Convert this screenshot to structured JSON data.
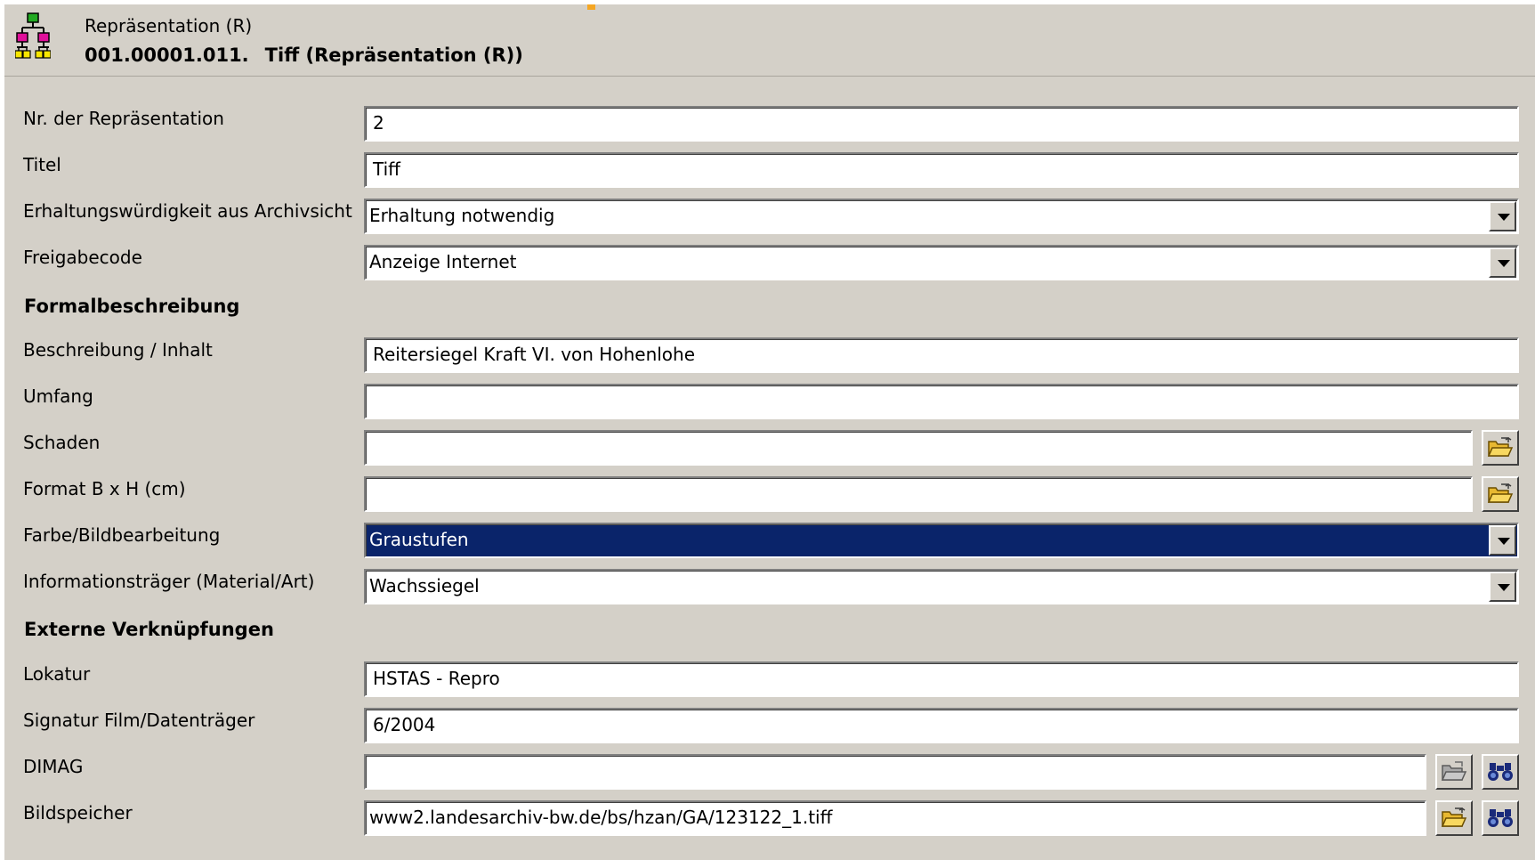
{
  "header": {
    "subtitle": "Repräsentation (R)",
    "title_number": "001.00001.011.",
    "title_text": "Tiff (Repräsentation (R))",
    "icon": "hierarchy-tree-icon"
  },
  "fields": {
    "nr": {
      "label": "Nr. der Repräsentation",
      "value": "2"
    },
    "titel": {
      "label": "Titel",
      "value": "Tiff"
    },
    "erhaltung": {
      "label": "Erhaltungswürdigkeit aus Archivsicht",
      "value": "Erhaltung notwendig"
    },
    "freigabe": {
      "label": "Freigabecode",
      "value": "Anzeige Internet"
    },
    "beschreibung": {
      "label": "Beschreibung / Inhalt",
      "value": "Reitersiegel Kraft VI. von Hohenlohe"
    },
    "umfang": {
      "label": "Umfang",
      "value": ""
    },
    "schaden": {
      "label": "Schaden",
      "value": ""
    },
    "format": {
      "label": "Format B x H (cm)",
      "value": ""
    },
    "farbe": {
      "label": "Farbe/Bildbearbeitung",
      "value": "Graustufen"
    },
    "traeger": {
      "label": "Informationsträger (Material/Art)",
      "value": "Wachssiegel"
    },
    "lokatur": {
      "label": "Lokatur",
      "value": "HSTAS - Repro"
    },
    "signatur": {
      "label": "Signatur Film/Datenträger",
      "value": "6/2004"
    },
    "dimag": {
      "label": "DIMAG",
      "value": ""
    },
    "bildspeicher": {
      "label": "Bildspeicher",
      "value": "www2.landesarchiv-bw.de/bs/hzan/GA/123122_1.tiff"
    }
  },
  "sections": {
    "formal": "Formalbeschreibung",
    "extern": "Externe Verknüpfungen"
  },
  "icons": {
    "folder": "open-folder-icon",
    "search": "binoculars-icon"
  },
  "colors": {
    "window_bg": "#d4d0c8",
    "selection_bg": "#0a246a",
    "accent": "#f5a623"
  }
}
